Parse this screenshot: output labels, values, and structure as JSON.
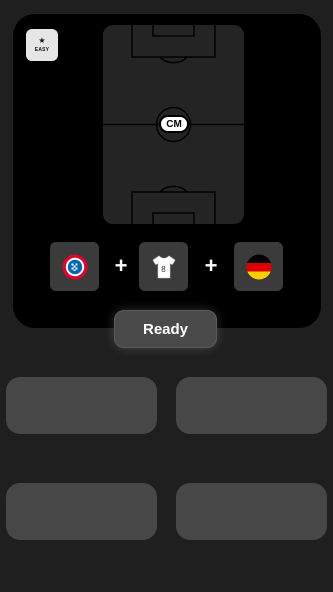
{
  "app": {
    "logo_text": "EASY"
  },
  "pitch": {
    "position_label": "CM"
  },
  "clues": {
    "slots": [
      {
        "icon": "club-crest-icon"
      },
      {
        "icon": "jersey-icon",
        "jersey_number": "8"
      },
      {
        "icon": "germany-flag-icon"
      }
    ],
    "plus_symbol": "+"
  },
  "ready_button": {
    "label": "Ready"
  },
  "answers": {
    "tiles": [
      "",
      "",
      "",
      ""
    ]
  },
  "colors": {
    "background": "#1f1f1f",
    "card": "#000000",
    "tile": "#474747",
    "club_red": "#dc052d",
    "club_blue": "#0066b2"
  }
}
